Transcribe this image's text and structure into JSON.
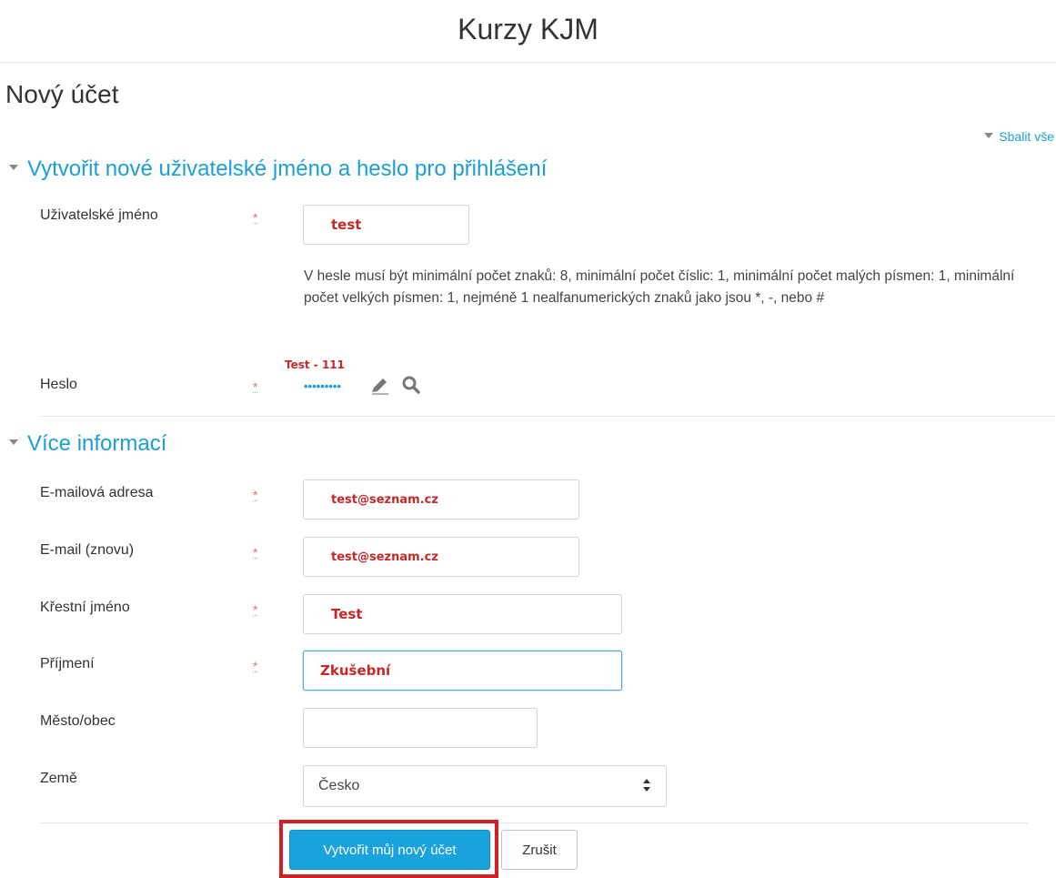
{
  "site": {
    "title": "Kurzy KJM"
  },
  "page": {
    "heading": "Nový účet",
    "collapse_all": "Sbalit vše"
  },
  "sections": {
    "login": {
      "title": "Vytvořit nové uživatelské jméno a heslo pro přihlášení"
    },
    "more": {
      "title": "Více informací"
    }
  },
  "fields": {
    "username": {
      "label": "Uživatelské jméno",
      "value": "test"
    },
    "password": {
      "hint": "V hesle musí být minimální počet znaků: 8, minimální počet číslic: 1, minimální počet malých písmen: 1, minimální počet velkých písmen: 1, nejméně 1 nealfanumerických znaků jako jsou *, -, nebo #",
      "label": "Heslo",
      "revealed": "Test - 111",
      "masked": "•••••••••"
    },
    "email": {
      "label": "E-mailová adresa",
      "value": "test@seznam.cz"
    },
    "email2": {
      "label": "E-mail (znovu)",
      "value": "test@seznam.cz"
    },
    "firstname": {
      "label": "Křestní jméno",
      "value": "Test"
    },
    "lastname": {
      "label": "Příjmení",
      "value": "Zkušební"
    },
    "city": {
      "label": "Město/obec",
      "value": ""
    },
    "country": {
      "label": "Země",
      "selected": "Česko"
    }
  },
  "required_marker": "*",
  "buttons": {
    "submit": "Vytvořit můj nový účet",
    "cancel": "Zrušit"
  },
  "colors": {
    "accent": "#1aa2dd",
    "highlight": "#d32027",
    "entered_text": "#c62828"
  }
}
